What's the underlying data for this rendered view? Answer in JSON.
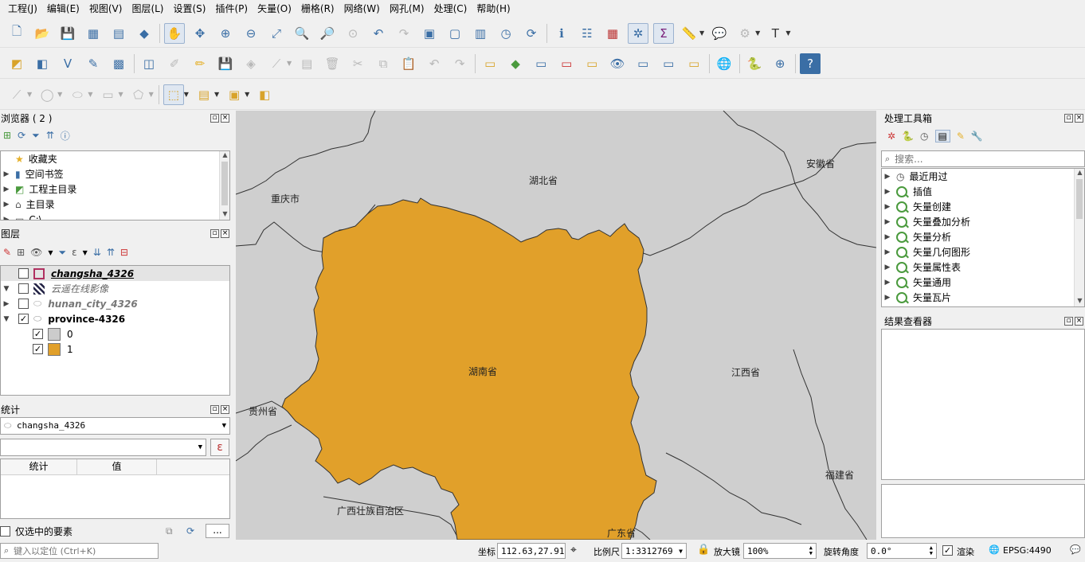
{
  "menu": [
    "工程(J)",
    "编辑(E)",
    "视图(V)",
    "图层(L)",
    "设置(S)",
    "插件(P)",
    "矢量(O)",
    "栅格(R)",
    "网络(W)",
    "网孔(M)",
    "处理(C)",
    "帮助(H)"
  ],
  "browser": {
    "title": "浏览器 ( 2 )",
    "items": [
      {
        "label": "收藏夹",
        "icon": "star-icon"
      },
      {
        "label": "空间书签",
        "icon": "bookmark-icon"
      },
      {
        "label": "工程主目录",
        "icon": "project-home-icon"
      },
      {
        "label": "主目录",
        "icon": "home-icon"
      },
      {
        "label": "C:\\",
        "icon": "drive-icon"
      }
    ]
  },
  "layers": {
    "title": "图层",
    "items": [
      {
        "name": "changsha_4326",
        "checked": false
      },
      {
        "name": "云遥在线影像",
        "checked": false
      },
      {
        "name": "hunan_city_4326",
        "checked": false
      },
      {
        "name": "province-4326",
        "checked": true
      }
    ],
    "legend": [
      {
        "label": "0",
        "color": "#cccccc",
        "checked": true
      },
      {
        "label": "1",
        "color": "#e1a02a",
        "checked": true
      }
    ]
  },
  "stats": {
    "title": "统计",
    "layer": "changsha_4326",
    "col_stat": "统计",
    "col_value": "值",
    "selected_only": "仅选中的要素",
    "expr_btn": "ε",
    "more_btn": "..."
  },
  "locator": {
    "placeholder": "键入以定位 (Ctrl+K)"
  },
  "toolbox": {
    "title": "处理工具箱",
    "search_placeholder": "搜索...",
    "items": [
      "最近用过",
      "插值",
      "矢量创建",
      "矢量叠加分析",
      "矢量分析",
      "矢量几何图形",
      "矢量属性表",
      "矢量通用",
      "矢量瓦片"
    ]
  },
  "results": {
    "title": "结果查看器"
  },
  "map": {
    "labels": {
      "hubei": "湖北省",
      "anhui": "安徽省",
      "chongqing": "重庆市",
      "hunan": "湖南省",
      "jiangxi": "江西省",
      "guizhou": "贵州省",
      "fujian": "福建省",
      "guangxi": "广西壮族自治区",
      "guangdong": "广东省"
    },
    "colors": {
      "background": "#cfcfcf",
      "highlight": "#e1a02a",
      "border": "#333333"
    }
  },
  "status": {
    "coord_label": "坐标",
    "coord": "112.63,27.91",
    "scale_label": "比例尺",
    "scale": "1:3312769",
    "magnifier_label": "放大镜",
    "magnifier": "100%",
    "rotation_label": "旋转角度",
    "rotation": "0.0°",
    "render_label": "渲染",
    "crs": "EPSG:4490"
  }
}
